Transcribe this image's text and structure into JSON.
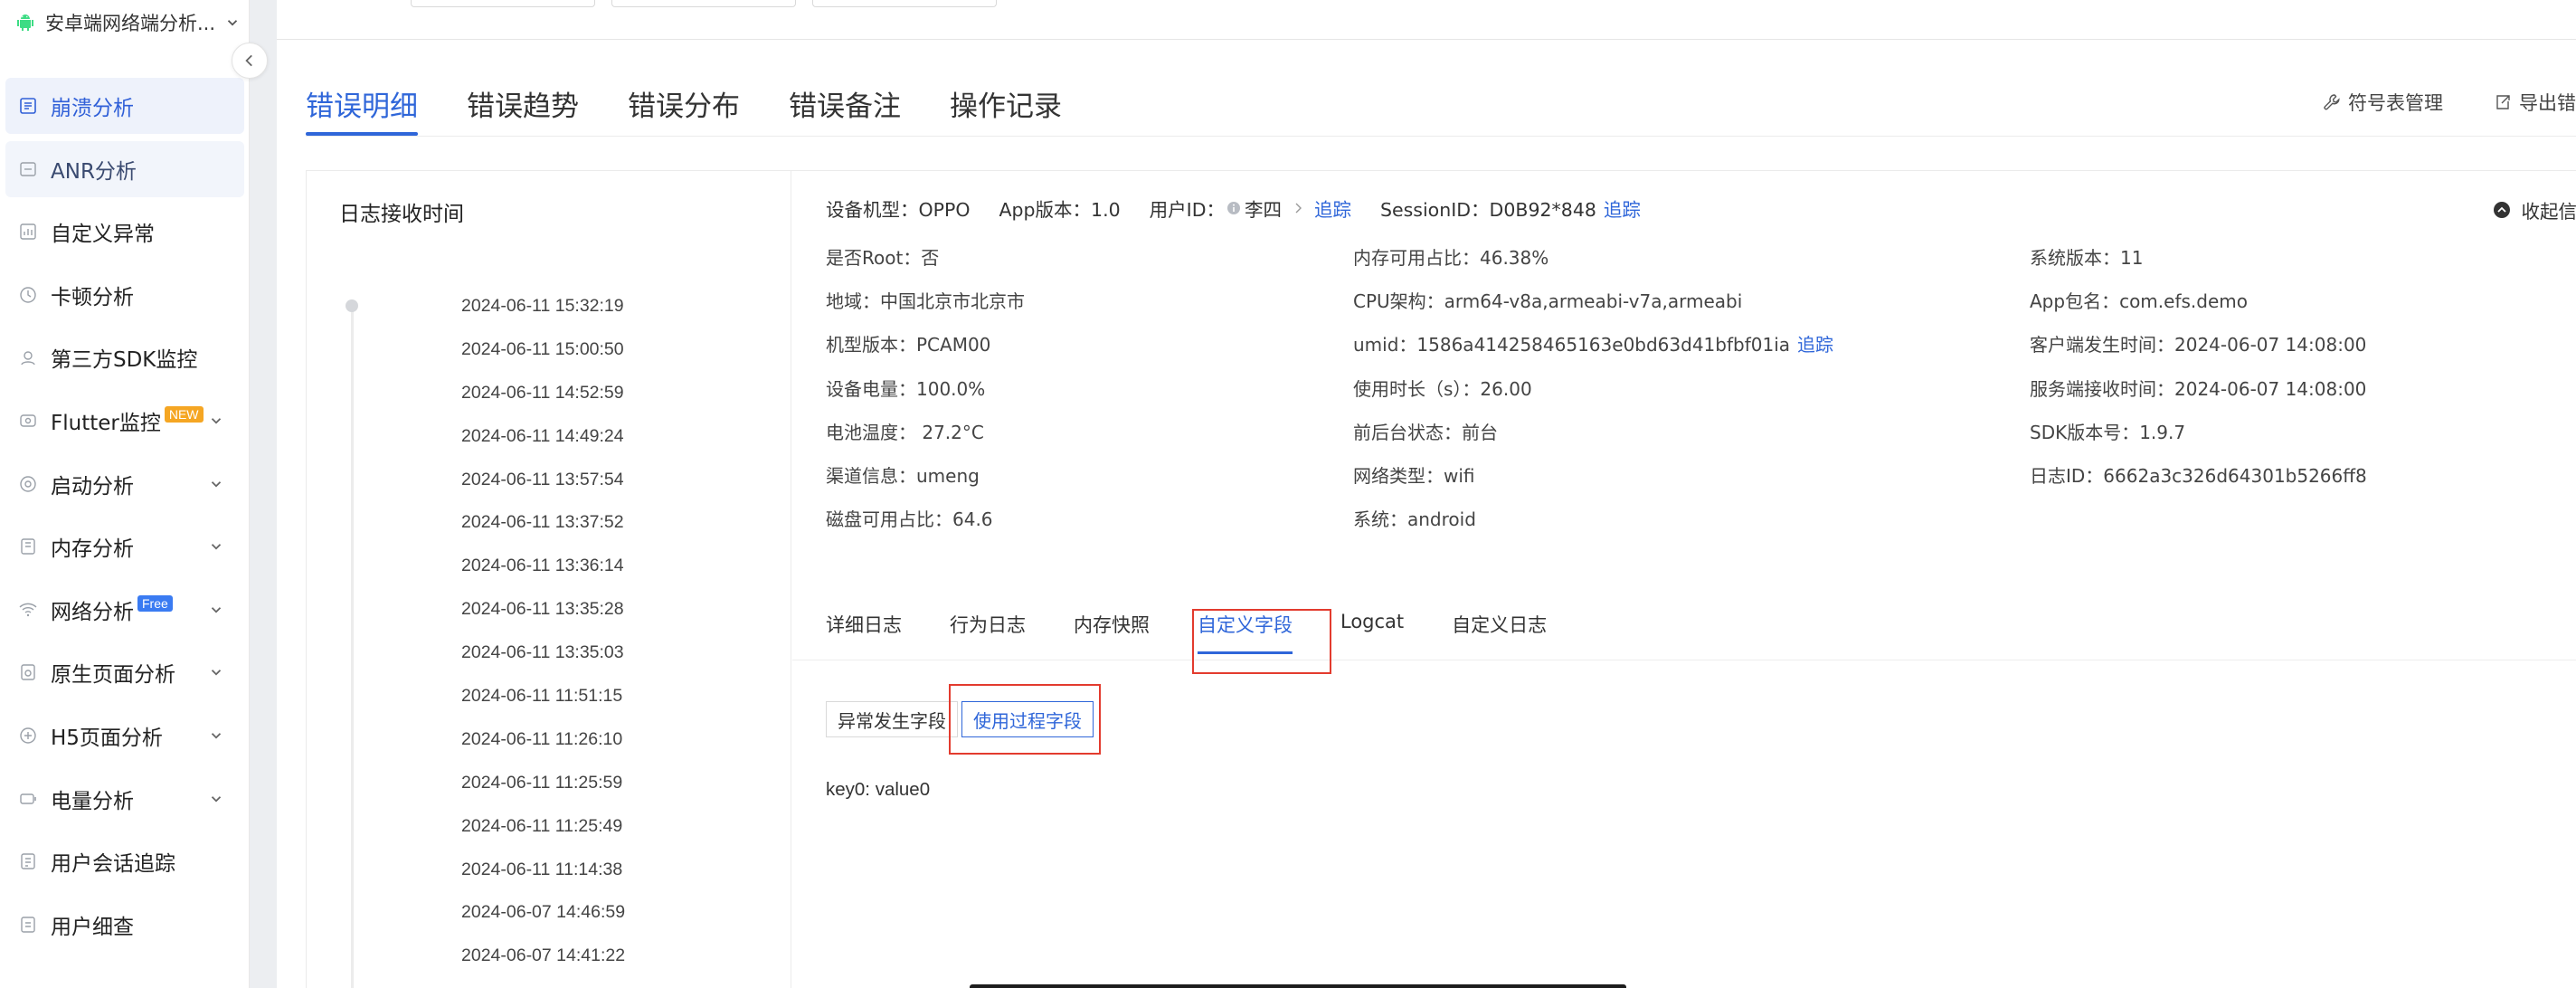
{
  "app": {
    "name": "安卓端网络端分析..."
  },
  "sidebar": {
    "items": [
      {
        "label": "崩溃分析",
        "icon": "report-icon",
        "state": "active"
      },
      {
        "label": "ANR分析",
        "icon": "anr-icon",
        "state": "active2"
      },
      {
        "label": "自定义异常",
        "icon": "chart-icon"
      },
      {
        "label": "卡顿分析",
        "icon": "history-icon"
      },
      {
        "label": "第三方SDK监控",
        "icon": "sdk-icon"
      },
      {
        "label": "Flutter监控",
        "icon": "flutter-icon",
        "badge": "NEW",
        "badge_type": "new",
        "expand": true
      },
      {
        "label": "启动分析",
        "icon": "startup-icon",
        "expand": true
      },
      {
        "label": "内存分析",
        "icon": "memory-icon",
        "expand": true
      },
      {
        "label": "网络分析",
        "icon": "wifi-icon",
        "badge": "Free",
        "badge_type": "free",
        "expand": true
      },
      {
        "label": "原生页面分析",
        "icon": "page-icon",
        "expand": true
      },
      {
        "label": "H5页面分析",
        "icon": "h5-icon",
        "expand": true
      },
      {
        "label": "电量分析",
        "icon": "battery-icon",
        "expand": true
      },
      {
        "label": "用户会话追踪",
        "icon": "session-icon"
      },
      {
        "label": "用户细查",
        "icon": "user-detail-icon"
      }
    ]
  },
  "tabs": [
    "错误明细",
    "错误趋势",
    "错误分布",
    "错误备注",
    "操作记录"
  ],
  "tools": {
    "symbol": "符号表管理",
    "export": "导出错"
  },
  "log_panel": {
    "title": "日志接收时间",
    "times": [
      "2024-06-11 15:32:19",
      "2024-06-11 15:00:50",
      "2024-06-11 14:52:59",
      "2024-06-11 14:49:24",
      "2024-06-11 13:57:54",
      "2024-06-11 13:37:52",
      "2024-06-11 13:36:14",
      "2024-06-11 13:35:28",
      "2024-06-11 13:35:03",
      "2024-06-11 11:51:15",
      "2024-06-11 11:26:10",
      "2024-06-11 11:25:59",
      "2024-06-11 11:25:49",
      "2024-06-11 11:14:38",
      "2024-06-07 14:46:59",
      "2024-06-07 14:41:22"
    ]
  },
  "device_header": {
    "model": "设备机型：OPPO",
    "app_version": "App版本：1.0",
    "user_label": "用户ID：",
    "user_name": "李四",
    "trace": "追踪",
    "session": "SessionID：D0B92*848",
    "collapse": "收起信"
  },
  "info": {
    "col1": [
      "是否Root：否",
      "地域：中国北京市北京市",
      "机型版本：PCAM00",
      "设备电量：100.0%",
      "电池温度： 27.2°C",
      "渠道信息：umeng",
      "磁盘可用占比：64.6"
    ],
    "col2": [
      "内存可用占比：46.38%",
      "CPU架构：arm64-v8a,armeabi-v7a,armeabi",
      "umid：1586a414258465163e0bd63d41bfbf01ia",
      "使用时长（s）：26.00",
      "前后台状态：前台",
      "网络类型：wifi",
      "系统：android"
    ],
    "col3": [
      "系统版本：11",
      "App包名：com.efs.demo",
      "客户端发生时间：2024-06-07 14:08:00",
      "服务端接收时间：2024-06-07 14:08:00",
      "SDK版本号：1.9.7",
      "日志ID：6662a3c326d64301b5266ff8"
    ]
  },
  "subtabs": [
    "详细日志",
    "行为日志",
    "内存快照",
    "自定义字段",
    "Logcat",
    "自定义日志"
  ],
  "segments": [
    "异常发生字段",
    "使用过程字段"
  ],
  "kv": "key0: value0"
}
